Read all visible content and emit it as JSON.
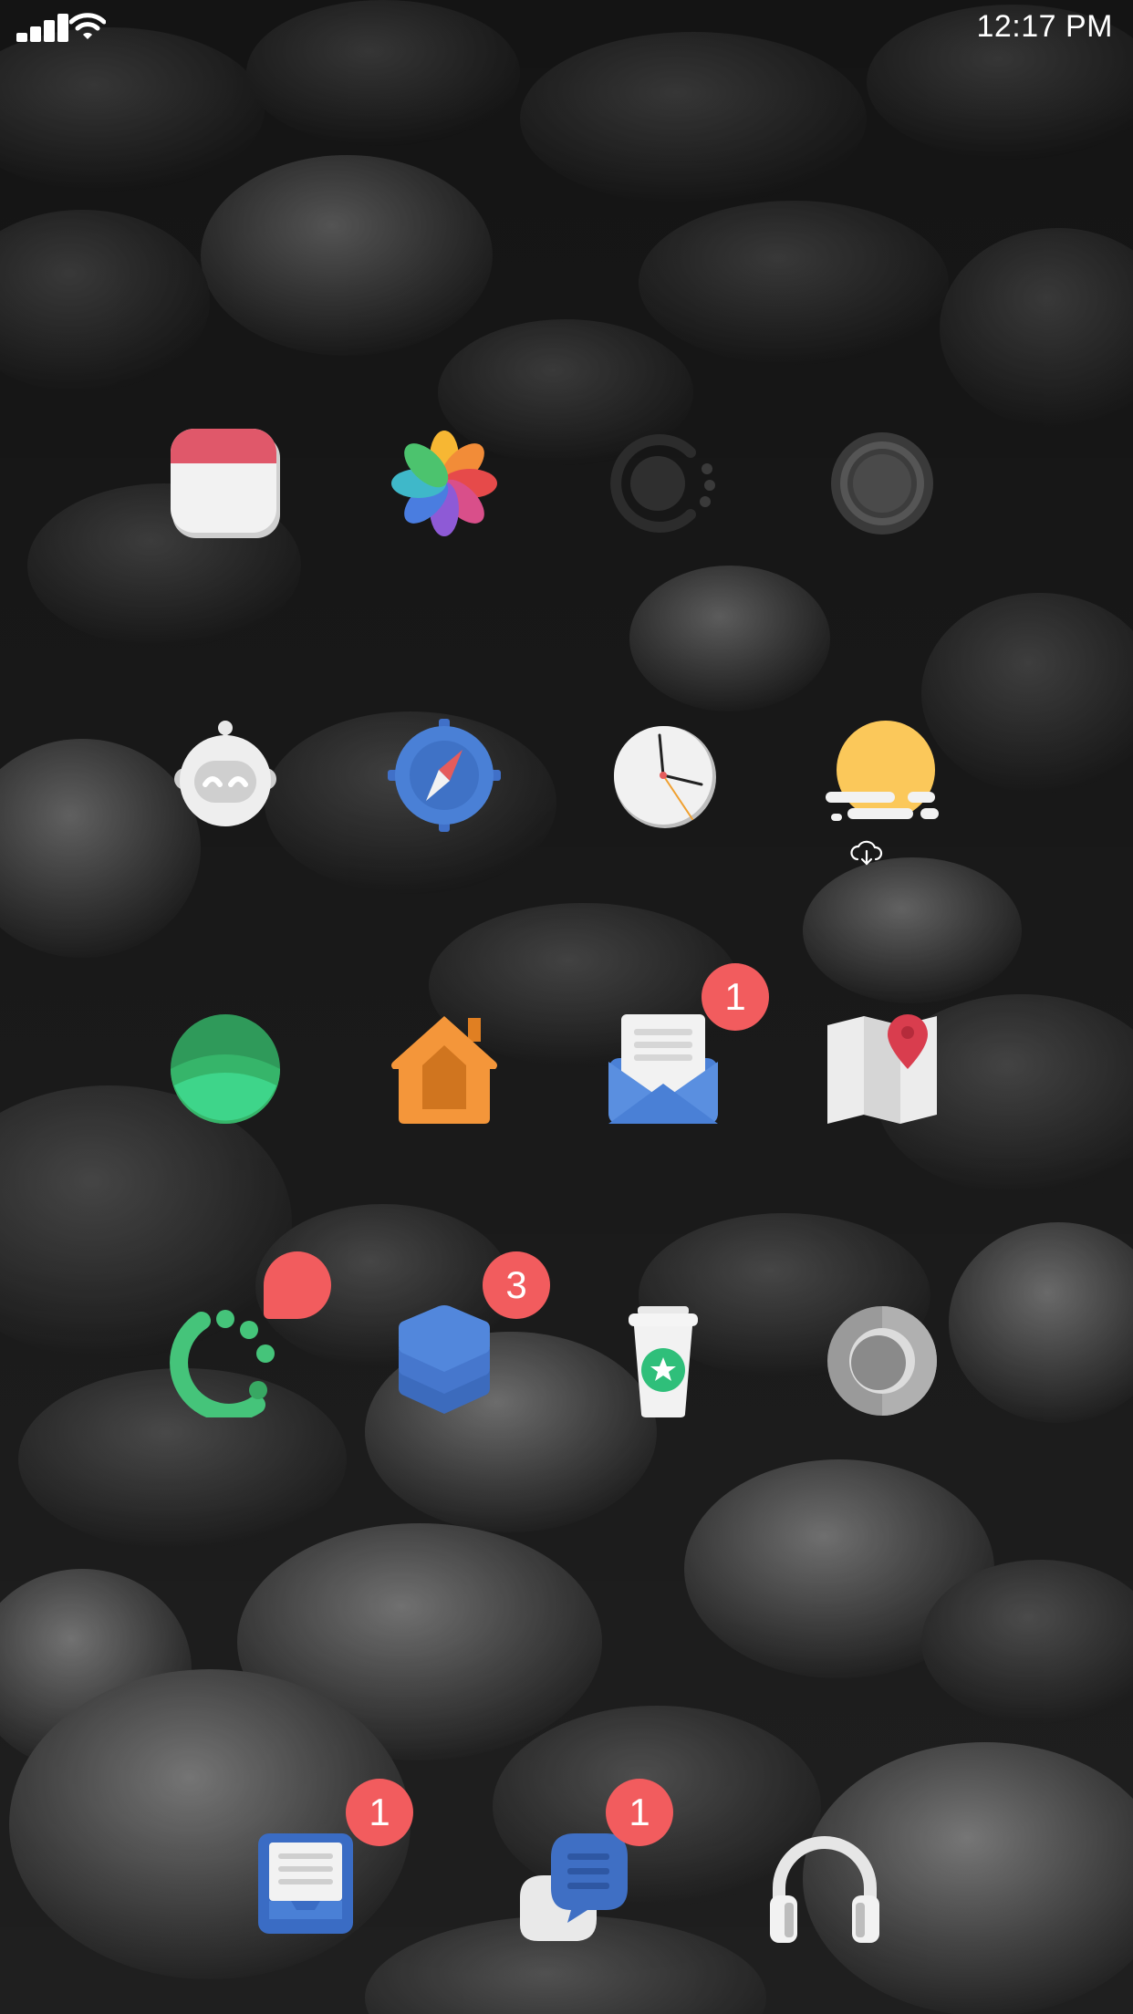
{
  "status_bar": {
    "time": "12:17 PM"
  },
  "home_screen": {
    "rows": [
      [
        {
          "name": "calendar-app",
          "icon": "calendar-icon"
        },
        {
          "name": "photos-app",
          "icon": "pinwheel-photos-icon"
        },
        {
          "name": "activity-app",
          "icon": "dark-ring-dots-icon"
        },
        {
          "name": "camera-app",
          "icon": "grey-ring-icon"
        }
      ],
      [
        {
          "name": "robot-app",
          "icon": "robot-icon"
        },
        {
          "name": "safari-app",
          "icon": "compass-icon"
        },
        {
          "name": "clock-app",
          "icon": "clock-icon"
        },
        {
          "name": "weather-app",
          "icon": "sun-cloud-icon",
          "status_icon": "icloud-download-icon"
        }
      ],
      [
        {
          "name": "green-circle-app",
          "icon": "green-circle-icon"
        },
        {
          "name": "home-app",
          "icon": "house-icon"
        },
        {
          "name": "mail-app",
          "icon": "envelope-icon",
          "badge": "1"
        },
        {
          "name": "maps-app",
          "icon": "map-pin-icon"
        }
      ],
      [
        {
          "name": "loading-app",
          "icon": "green-dots-arc-icon",
          "badge": ""
        },
        {
          "name": "layers-app",
          "icon": "stacked-layers-icon",
          "badge": "3"
        },
        {
          "name": "coffee-app",
          "icon": "coffee-cup-star-icon"
        },
        {
          "name": "music-app",
          "icon": "grey-disc-icon"
        }
      ]
    ]
  },
  "dock": [
    {
      "name": "notes-app",
      "icon": "tray-document-icon",
      "badge": "1"
    },
    {
      "name": "messages-app",
      "icon": "chat-bubbles-icon",
      "badge": "1"
    },
    {
      "name": "headphones-app",
      "icon": "headphones-icon"
    }
  ],
  "colors": {
    "badge": "#f25c5e",
    "wallpaper": "#1e1e1e"
  }
}
